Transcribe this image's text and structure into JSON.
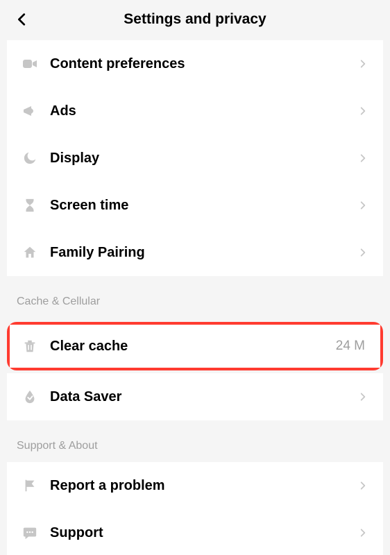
{
  "header": {
    "title": "Settings and privacy"
  },
  "group1": {
    "items": [
      {
        "label": "Content preferences"
      },
      {
        "label": "Ads"
      },
      {
        "label": "Display"
      },
      {
        "label": "Screen time"
      },
      {
        "label": "Family Pairing"
      }
    ]
  },
  "group2": {
    "title": "Cache & Cellular",
    "items": [
      {
        "label": "Clear cache",
        "value": "24 M"
      },
      {
        "label": "Data Saver"
      }
    ]
  },
  "group3": {
    "title": "Support & About",
    "items": [
      {
        "label": "Report a problem"
      },
      {
        "label": "Support"
      }
    ]
  }
}
